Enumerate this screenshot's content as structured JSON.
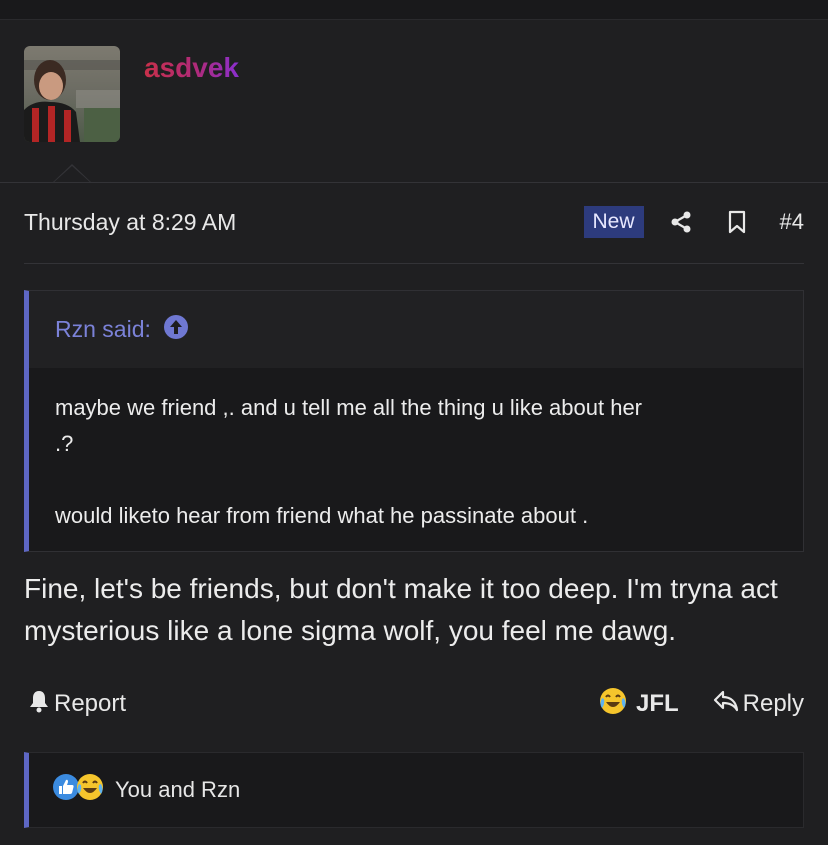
{
  "post": {
    "username": "asdvek",
    "timestamp": "Thursday at 8:29 AM",
    "new_badge": "New",
    "post_number": "#4"
  },
  "quote": {
    "author": "Rzn said:",
    "line1": "maybe we friend ,. and u tell me all the thing u like about her",
    "line2": ".?",
    "line3": "would liketo hear from friend what he passinate about ."
  },
  "message": {
    "text": "Fine, let's be friends, but don't make it too deep. I'm tryna act mysterious like a lone sigma wolf, you feel me dawg."
  },
  "actions": {
    "report": "Report",
    "reaction": "JFL",
    "reply": "Reply"
  },
  "reactions": {
    "summary": "You and Rzn"
  },
  "colors": {
    "accent": "#5e67c4",
    "new_badge_bg": "#2d3b7d",
    "background": "#1f1f21"
  }
}
